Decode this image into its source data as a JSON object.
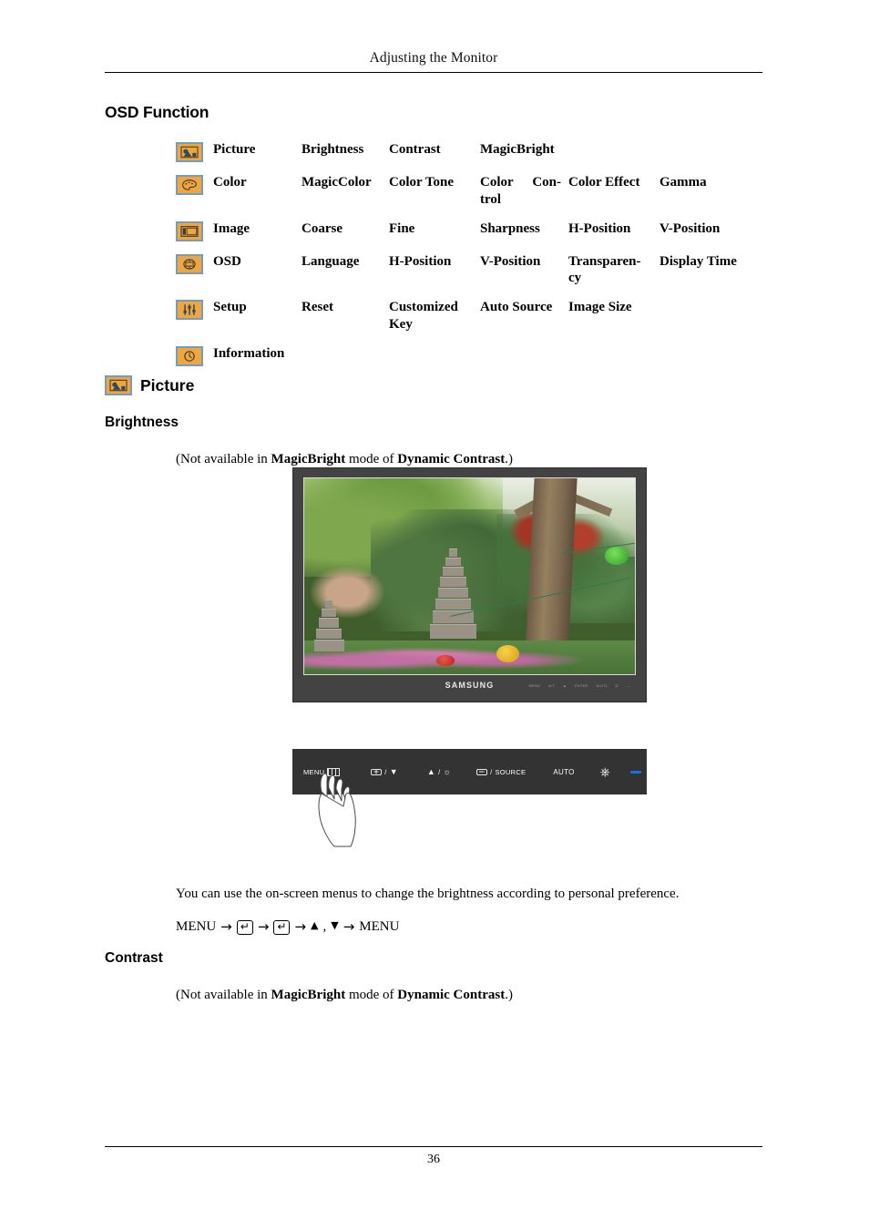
{
  "header": {
    "running_title": "Adjusting the Monitor"
  },
  "headings": {
    "osd_function": "OSD Function",
    "picture": "Picture",
    "brightness": "Brightness",
    "contrast": "Contrast"
  },
  "osd_table": {
    "rows": [
      {
        "icon": "picture-menu-icon",
        "name": "Picture",
        "items": [
          "Brightness",
          "Contrast",
          "MagicBright",
          "",
          ""
        ]
      },
      {
        "icon": "color-menu-icon",
        "name": "Color",
        "items": [
          "MagicColor",
          "Color Tone",
          "Color Con-trol",
          "Color Effect",
          "Gamma"
        ],
        "item3_part1": "Color",
        "item3_part2": "Con-",
        "item3_part3": "trol"
      },
      {
        "icon": "image-menu-icon",
        "name": "Image",
        "items": [
          "Coarse",
          "Fine",
          "Sharpness",
          "H-Position",
          "V-Position"
        ]
      },
      {
        "icon": "osd-menu-icon",
        "name": "OSD",
        "items": [
          "Language",
          "H-Position",
          "V-Position",
          "Transparen-cy",
          "Display Time"
        ],
        "item4_part1": "Transparen-",
        "item4_part2": "cy"
      },
      {
        "icon": "setup-menu-icon",
        "name": "Setup",
        "items": [
          "Reset",
          "Customized Key",
          "Auto Source",
          "Image Size",
          ""
        ],
        "item2_part1": "Customized",
        "item2_part2": "Key"
      },
      {
        "icon": "information-menu-icon",
        "name": "Information",
        "items": [
          "",
          "",
          "",
          "",
          ""
        ]
      }
    ]
  },
  "brightness_section": {
    "note_prefix": "(Not available in ",
    "note_bold1": "MagicBright",
    "note_middle": " mode of ",
    "note_bold2": "Dynamic Contrast",
    "note_suffix": ".)",
    "description": "You can use the on-screen menus to change the brightness according to personal preference.",
    "menu_path": {
      "start": "MENU",
      "arrow": "→",
      "enter_key": "↵",
      "up_triangle": "▲",
      "comma": ",",
      "down_triangle": "▼",
      "end": "MENU"
    }
  },
  "contrast_section": {
    "note_prefix": "(Not available in ",
    "note_bold1": "MagicBright",
    "note_middle": " mode of ",
    "note_bold2": "Dynamic Contrast",
    "note_suffix": ".)"
  },
  "monitor_figure": {
    "brand": "SAMSUNG",
    "bezel_keys": [
      "MENU",
      "A/T",
      "▲",
      "ENTER",
      "AUTO",
      "⏻",
      "—"
    ],
    "screen_description": "Korean garden photograph with stone pagoda, trees and paper lanterns"
  },
  "control_panel": {
    "keys": [
      {
        "name": "menu-button",
        "label": "MENU",
        "icon": "menu-grid-icon"
      },
      {
        "name": "enter-down-button",
        "label": "",
        "icon": "enter-key-icon",
        "separator": "/",
        "glyph": "▼"
      },
      {
        "name": "up-brightness-button",
        "label": "",
        "glyph": "▲",
        "separator": "/",
        "icon": "brightness-sun-icon"
      },
      {
        "name": "source-button",
        "label": "SOURCE",
        "icon": "enter-key-icon",
        "separator": "/"
      },
      {
        "name": "auto-button",
        "label": "AUTO"
      },
      {
        "name": "power-button",
        "label": "",
        "icon": "power-icon"
      },
      {
        "name": "power-indicator",
        "label": "",
        "icon": "power-led-indicator"
      }
    ]
  },
  "footer": {
    "page_number": "36"
  },
  "colors": {
    "icon_fill": "#f0a63c",
    "icon_border": "#6f9dc4",
    "panel_background": "#333333",
    "bezel": "#434343",
    "led_blue": "#1f6fe0"
  }
}
